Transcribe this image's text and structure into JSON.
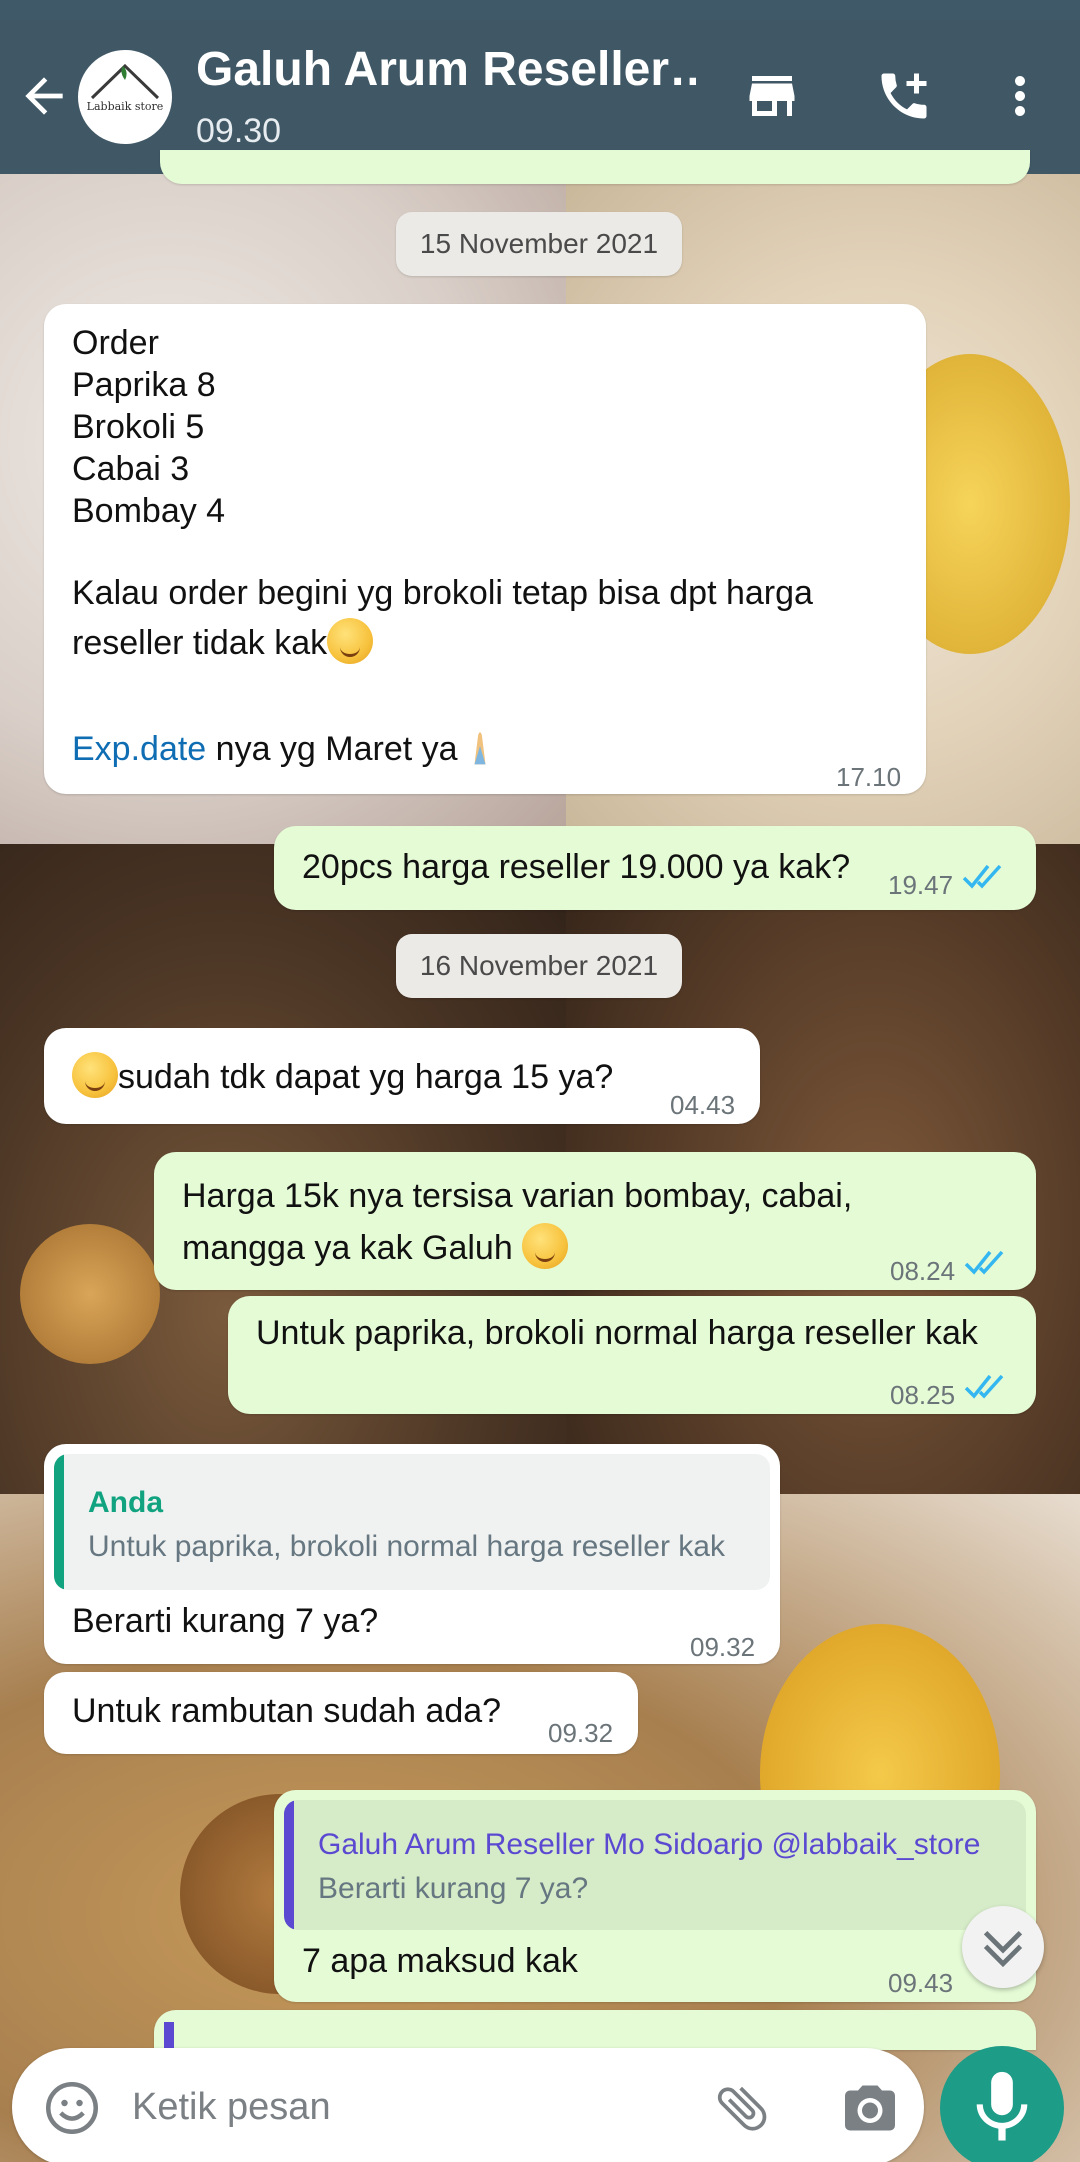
{
  "header": {
    "title": "Galuh Arum Reseller…",
    "subtitle": "09.30",
    "avatar_text": "Labbaik store",
    "icons": [
      "back-arrow-icon",
      "store-icon",
      "add-call-icon",
      "more-vert-icon"
    ]
  },
  "chat": {
    "date_1": "15 November 2021",
    "msg1": {
      "lines": [
        "Order",
        "Paprika 8",
        "Brokoli 5",
        "Cabai 3",
        "Bombay 4"
      ],
      "para1": "Kalau order begini yg brokoli tetap bisa dpt harga reseller tidak kak",
      "link": "Exp.date",
      "para2_rest": " nya yg Maret ya",
      "time": "17.10"
    },
    "msg2": {
      "text": "20pcs harga reseller 19.000 ya kak?",
      "time": "19.47"
    },
    "date_2": "16 November 2021",
    "msg3": {
      "text": "sudah tdk dapat yg harga 15 ya?",
      "time": "04.43"
    },
    "msg4": {
      "line1": "Harga 15k nya tersisa varian bombay, cabai,",
      "line2": "mangga ya kak Galuh ",
      "time": "08.24"
    },
    "msg5": {
      "text": "Untuk paprika, brokoli normal harga reseller kak",
      "time": "08.25"
    },
    "msg6": {
      "quote_name": "Anda",
      "quote_text": "Untuk paprika, brokoli normal harga reseller kak",
      "text": "Berarti kurang 7 ya?",
      "time": "09.32"
    },
    "msg7": {
      "text": "Untuk rambutan sudah ada?",
      "time": "09.32"
    },
    "msg8": {
      "quote_name": "Galuh Arum Reseller Mo Sidoarjo @labbaik_store",
      "quote_text": "Berarti kurang 7 ya?",
      "text": "7 apa maksud kak",
      "time": "09.43"
    }
  },
  "composer": {
    "placeholder": "Ketik pesan"
  },
  "colors": {
    "header": "#405866",
    "outgoing": "#e5fbd6",
    "incoming": "#ffffff",
    "accent": "#1d9c88",
    "read_ticks": "#34b7f1"
  }
}
